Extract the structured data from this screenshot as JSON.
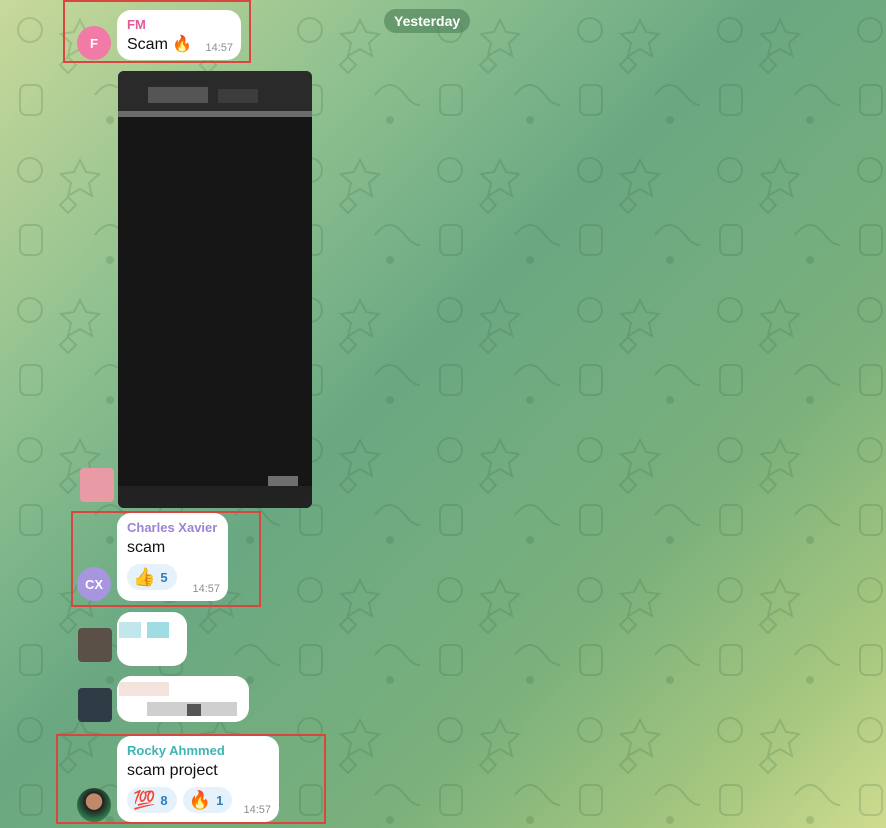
{
  "date_separator": "Yesterday",
  "messages": [
    {
      "sender": "FM",
      "avatar_initial": "F",
      "text": "Scam 🔥",
      "time": "14:57",
      "sender_color": "#e35a9a",
      "avatar_color": "#f27aa7"
    },
    {
      "sender": "Charles Xavier",
      "avatar_initial": "CX",
      "text": "scam",
      "time": "14:57",
      "sender_color": "#9b84d6",
      "avatar_color": "#a895e0",
      "reactions": [
        {
          "emoji": "👍",
          "count": "5",
          "icon": "thumbs-up-icon"
        }
      ]
    },
    {
      "sender": "Rocky Ahmmed",
      "text": "scam project",
      "time": "14:57",
      "sender_color": "#3fb4b4",
      "reactions": [
        {
          "emoji": "💯",
          "count": "8",
          "icon": "hundred-points-icon"
        },
        {
          "emoji": "🔥",
          "count": "1",
          "icon": "fire-icon"
        }
      ]
    }
  ],
  "colors": {
    "highlight": "#d9453f",
    "reaction_bg": "#e6f2fb",
    "reaction_text": "#2b7ec1"
  }
}
